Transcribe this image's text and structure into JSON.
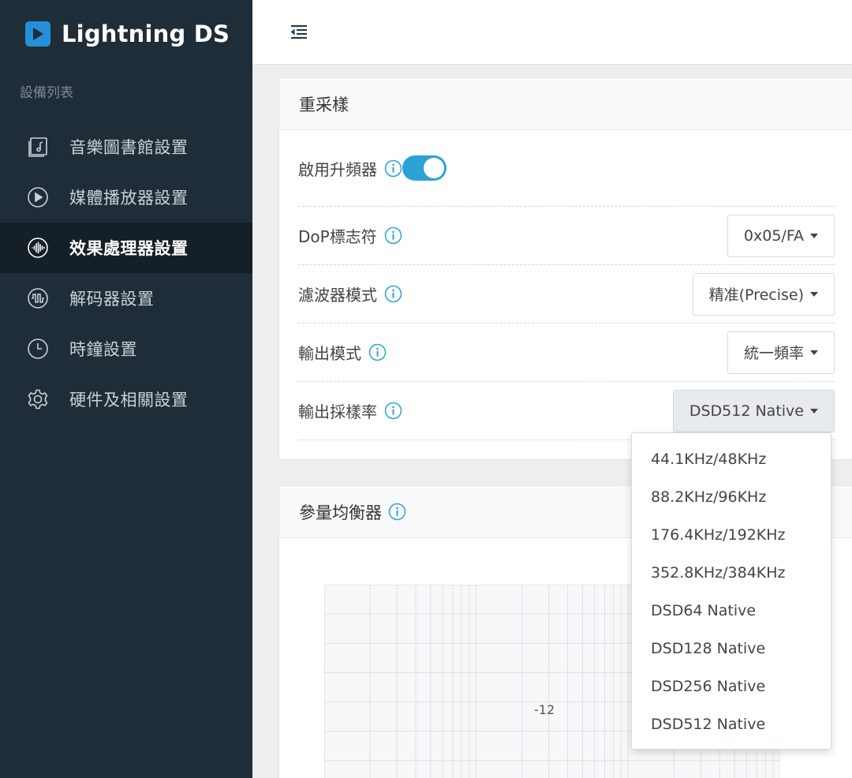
{
  "app": {
    "title": "Lightning DS"
  },
  "sidebar": {
    "section_label": "設備列表",
    "items": [
      {
        "label": "音樂圖書館設置",
        "icon": "music-library-icon",
        "active": false
      },
      {
        "label": "媒體播放器設置",
        "icon": "play-circle-icon",
        "active": false
      },
      {
        "label": "效果處理器設置",
        "icon": "waveform-icon",
        "active": true
      },
      {
        "label": "解码器設置",
        "icon": "signal-wave-icon",
        "active": false
      },
      {
        "label": "時鐘設置",
        "icon": "clock-icon",
        "active": false
      },
      {
        "label": "硬件及相關設置",
        "icon": "gear-icon",
        "active": false
      }
    ]
  },
  "topbar": {
    "menu_icon": "menu-collapse-icon"
  },
  "resample": {
    "title": "重采樣",
    "rows": [
      {
        "label": "啟用升頻器",
        "control": "toggle",
        "enabled": true
      },
      {
        "label": "DoP標志符",
        "control": "select",
        "value": "0x05/FA"
      },
      {
        "label": "濾波器模式",
        "control": "select",
        "value": "精准(Precise)"
      },
      {
        "label": "輸出模式",
        "control": "select",
        "value": "統一頻率"
      },
      {
        "label": "輸出採樣率",
        "control": "select",
        "value": "DSD512 Native"
      }
    ]
  },
  "sample_rate_dropdown": {
    "options": [
      "44.1KHz/48KHz",
      "88.2KHz/96KHz",
      "176.4KHz/192KHz",
      "352.8KHz/384KHz",
      "DSD64 Native",
      "DSD128 Native",
      "DSD256 Native",
      "DSD512 Native"
    ]
  },
  "eq": {
    "title": "參量均衡器",
    "axis_label": "-12"
  },
  "colors": {
    "sidebar_bg": "#1f2d38",
    "sidebar_active_bg": "#141f28",
    "accent": "#2ba3d6",
    "brand_blue": "#2590d9",
    "info_icon": "#2ba3d6"
  }
}
